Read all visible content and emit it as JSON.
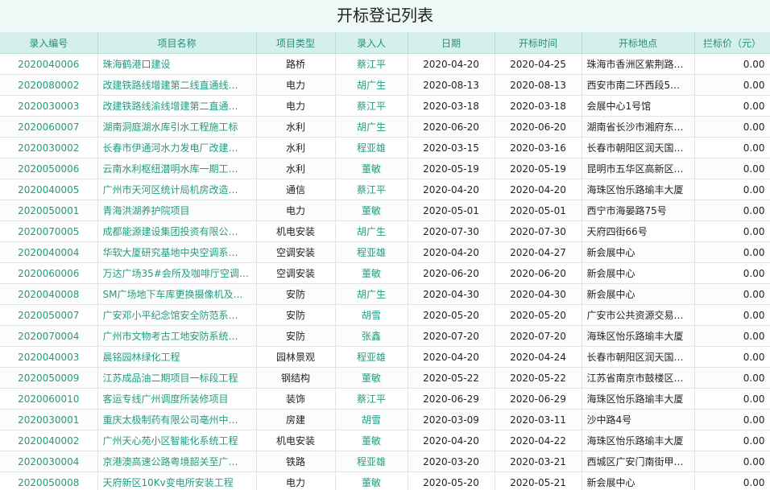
{
  "page": {
    "title": "开标登记列表"
  },
  "columns": [
    "录入编号",
    "项目名称",
    "项目类型",
    "录入人",
    "日期",
    "开标时间",
    "开标地点",
    "拦标价（元）"
  ],
  "rows": [
    [
      "2020040006",
      "珠海鹤港口建设",
      "路桥",
      "蔡江平",
      "2020-04-20",
      "2020-04-25",
      "珠海市香洲区紫荆路…",
      "0.00"
    ],
    [
      "2020080002",
      "改建铁路线增建第二线直通线…",
      "电力",
      "胡广生",
      "2020-08-13",
      "2020-08-13",
      "西安市南二环西段5…",
      "0.00"
    ],
    [
      "2020030003",
      "改建铁路线渝线增建第二直通…",
      "电力",
      "蔡江平",
      "2020-03-18",
      "2020-03-18",
      "会展中心1号馆",
      "0.00"
    ],
    [
      "2020060007",
      "湖南洞庭湖水库引水工程施工标",
      "水利",
      "胡广生",
      "2020-06-20",
      "2020-06-20",
      "湖南省长沙市湘府东…",
      "0.00"
    ],
    [
      "2020030002",
      "长春市伊通河水力发电厂改建…",
      "水利",
      "程亚雄",
      "2020-03-15",
      "2020-03-16",
      "长春市朝阳区润天国…",
      "0.00"
    ],
    [
      "2020050006",
      "云南水利枢纽潜明水库一期工…",
      "水利",
      "董敏",
      "2020-05-19",
      "2020-05-19",
      "昆明市五华区高新区…",
      "0.00"
    ],
    [
      "2020040005",
      "广州市天河区统计局机房改造…",
      "通信",
      "蔡江平",
      "2020-04-20",
      "2020-04-20",
      "海珠区怡乐路瑜丰大厦",
      "0.00"
    ],
    [
      "2020050001",
      "青海洪湖养护院项目",
      "电力",
      "董敏",
      "2020-05-01",
      "2020-05-01",
      "西宁市海晏路75号",
      "0.00"
    ],
    [
      "2020070005",
      "成都能源建设集团投资有限公…",
      "机电安装",
      "胡广生",
      "2020-07-30",
      "2020-07-30",
      "天府四街66号",
      "0.00"
    ],
    [
      "2020040004",
      "华软大厦研究基地中央空调系…",
      "空调安装",
      "程亚雄",
      "2020-04-20",
      "2020-04-27",
      "新会展中心",
      "0.00"
    ],
    [
      "2020060006",
      "万达广场35#会所及咖啡厅空调…",
      "空调安装",
      "董敏",
      "2020-06-20",
      "2020-06-20",
      "新会展中心",
      "0.00"
    ],
    [
      "2020040008",
      "SM广场地下车库更换摄像机及…",
      "安防",
      "胡广生",
      "2020-04-30",
      "2020-04-30",
      "新会展中心",
      "0.00"
    ],
    [
      "2020050007",
      "广安邓小平纪念馆安全防范系…",
      "安防",
      "胡雪",
      "2020-05-20",
      "2020-05-20",
      "广安市公共资源交易…",
      "0.00"
    ],
    [
      "2020070004",
      "广州市文物考古工地安防系统…",
      "安防",
      "张鑫",
      "2020-07-20",
      "2020-07-20",
      "海珠区怡乐路瑜丰大厦",
      "0.00"
    ],
    [
      "2020040003",
      "晨铭园林绿化工程",
      "园林景观",
      "程亚雄",
      "2020-04-20",
      "2020-04-24",
      "长春市朝阳区润天国…",
      "0.00"
    ],
    [
      "2020050009",
      "江苏成品油二期项目一标段工程",
      "钢结构",
      "董敏",
      "2020-05-22",
      "2020-05-22",
      "江苏省南京市鼓楼区…",
      "0.00"
    ],
    [
      "2020060010",
      "客运专线广州调度所装修项目",
      "装饰",
      "蔡江平",
      "2020-06-29",
      "2020-06-29",
      "海珠区怡乐路瑜丰大厦",
      "0.00"
    ],
    [
      "2020030001",
      "重庆太极制药有限公司亳州中…",
      "房建",
      "胡雪",
      "2020-03-09",
      "2020-03-11",
      "沙中路4号",
      "0.00"
    ],
    [
      "2020040002",
      "广州天心苑小区智能化系统工程",
      "机电安装",
      "董敏",
      "2020-04-20",
      "2020-04-22",
      "海珠区怡乐路瑜丰大厦",
      "0.00"
    ],
    [
      "2020030004",
      "京港澳高速公路粤境韶关至广…",
      "铁路",
      "程亚雄",
      "2020-03-20",
      "2020-03-21",
      "西城区广安门南街甲…",
      "0.00"
    ],
    [
      "2020050008",
      "天府新区10Kv变电所安装工程",
      "电力",
      "董敏",
      "2020-05-20",
      "2020-05-21",
      "新会展中心",
      "0.00"
    ]
  ]
}
